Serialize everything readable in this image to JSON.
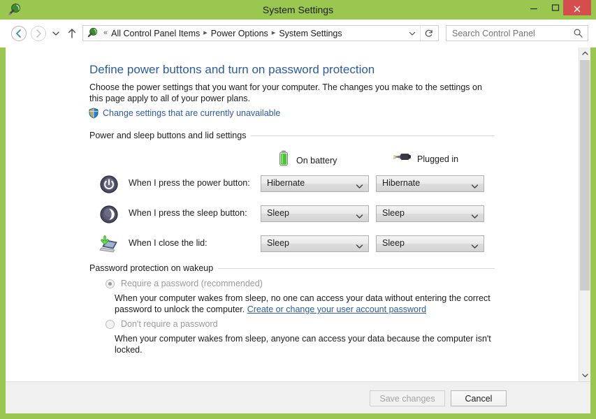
{
  "window": {
    "title": "System Settings",
    "icon": "power-plug-icon",
    "accent_green": "#9ac74f",
    "close_red": "#d64d4d",
    "controls": {
      "minimize": "minimize-icon",
      "maximize": "maximize-icon",
      "close": "close-icon"
    }
  },
  "navbar": {
    "back": "back-arrow-icon",
    "forward": "forward-arrow-icon",
    "recent": "recent-pages-chevron-icon",
    "up": "up-arrow-icon",
    "address_icon": "power-plug-icon",
    "breadcrumb_prefix": "«",
    "breadcrumbs": [
      "All Control Panel Items",
      "Power Options",
      "System Settings"
    ],
    "separator": "▸",
    "dropdown": "chevron-down-icon",
    "refresh": "refresh-icon",
    "search": {
      "placeholder": "Search Control Panel",
      "value": "",
      "icon": "search-icon"
    }
  },
  "page": {
    "title": "Define power buttons and turn on password protection",
    "description": "Choose the power settings that you want for your computer. The changes you make to the settings on this page apply to all of your power plans.",
    "uac_link": {
      "icon": "uac-shield-icon",
      "label": "Change settings that are currently unavailable"
    }
  },
  "power_group": {
    "heading": "Power and sleep buttons and lid settings",
    "columns": [
      {
        "icon": "battery-icon",
        "label": "On battery"
      },
      {
        "icon": "power-plug-icon",
        "label": "Plugged in"
      }
    ],
    "rows": [
      {
        "icon": "power-button-icon",
        "label": "When I press the power button:",
        "on_battery": "Hibernate",
        "plugged_in": "Hibernate"
      },
      {
        "icon": "sleep-button-icon",
        "label": "When I press the sleep button:",
        "on_battery": "Sleep",
        "plugged_in": "Sleep"
      },
      {
        "icon": "laptop-lid-icon",
        "label": "When I close the lid:",
        "on_battery": "Sleep",
        "plugged_in": "Sleep"
      }
    ]
  },
  "password_group": {
    "heading": "Password protection on wakeup",
    "options": [
      {
        "label": "Require a password (recommended)",
        "selected": true,
        "disabled": true,
        "description_before": "When your computer wakes from sleep, no one can access your data without entering the correct password to unlock the computer. ",
        "link": "Create or change your user account password",
        "description_after": ""
      },
      {
        "label": "Don't require a password",
        "selected": false,
        "disabled": true,
        "description_before": "When your computer wakes from sleep, anyone can access your data because the computer isn't locked.",
        "link": "",
        "description_after": ""
      }
    ]
  },
  "footer": {
    "save_label": "Save changes",
    "save_disabled": true,
    "cancel_label": "Cancel"
  },
  "scrollbar": {
    "up_icon": "scroll-up-icon",
    "down_icon": "scroll-down-icon",
    "thumb_percent": 72
  }
}
